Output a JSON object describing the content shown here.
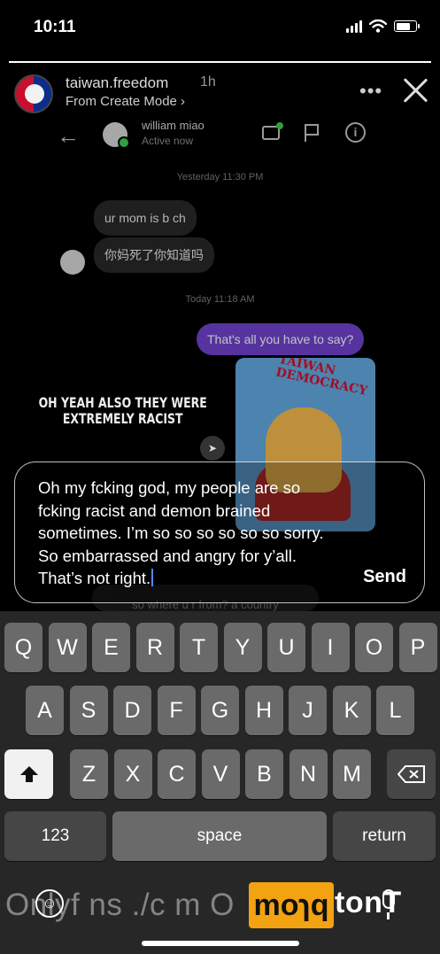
{
  "status_bar": {
    "time": "10:11",
    "battery_level": 0.75
  },
  "story": {
    "progress": 1.0,
    "user_name": "taiwan.freedom",
    "time_ago": "1h",
    "sub_label": "From Create Mode",
    "more_icon": "more-horizontal-icon",
    "close_icon": "close-icon",
    "overlay_text": "OH YEAH ALSO THEY WERE EXTREMELY RACIST"
  },
  "dm_screenshot": {
    "contact_name": "william miao",
    "contact_status": "Active now",
    "timestamp_1": "Yesterday 11:30 PM",
    "messages_in": [
      "ur mom is b  ch",
      "你妈死了你知道吗"
    ],
    "timestamp_2": "Today 11:18 AM",
    "message_out": "That's all you have to say?",
    "cartoon_title": "TAIWAN DEMOCRACY",
    "peek_message": "so where u r from?   a country"
  },
  "reply": {
    "text": "Oh my fcking god, my people are so fcking racist and demon brained sometimes. I’m so so so so so so sorry. So embarrassed and angry for y’all. That’s not right.",
    "send_label": "Send"
  },
  "keyboard": {
    "row1": [
      "Q",
      "W",
      "E",
      "R",
      "T",
      "Y",
      "U",
      "I",
      "O",
      "P"
    ],
    "row2": [
      "A",
      "S",
      "D",
      "F",
      "G",
      "H",
      "J",
      "K",
      "L"
    ],
    "row3": [
      "Z",
      "X",
      "C",
      "V",
      "B",
      "N",
      "M"
    ],
    "numbers_label": "123",
    "space_label": "space",
    "return_label": "return",
    "shift_icon": "shift-icon",
    "backspace_icon": "backspace-icon"
  },
  "overlay": {
    "watermark_text": "Onlyf ns ./c m O",
    "badge_text": "moɿq",
    "tail_text": "tonT",
    "emoji_icon": "emoji-icon",
    "mic_icon": "microphone-icon"
  }
}
